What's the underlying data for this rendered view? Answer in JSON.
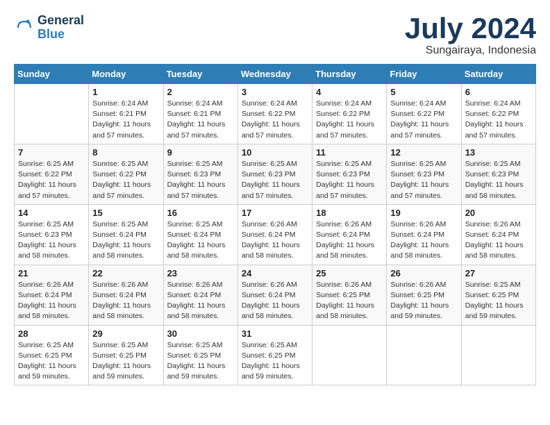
{
  "logo": {
    "line1": "General",
    "line2": "Blue"
  },
  "title": "July 2024",
  "subtitle": "Sungairaya, Indonesia",
  "weekdays": [
    "Sunday",
    "Monday",
    "Tuesday",
    "Wednesday",
    "Thursday",
    "Friday",
    "Saturday"
  ],
  "weeks": [
    [
      {
        "day": "",
        "info": ""
      },
      {
        "day": "1",
        "info": "Sunrise: 6:24 AM\nSunset: 6:21 PM\nDaylight: 11 hours\nand 57 minutes."
      },
      {
        "day": "2",
        "info": "Sunrise: 6:24 AM\nSunset: 6:21 PM\nDaylight: 11 hours\nand 57 minutes."
      },
      {
        "day": "3",
        "info": "Sunrise: 6:24 AM\nSunset: 6:22 PM\nDaylight: 11 hours\nand 57 minutes."
      },
      {
        "day": "4",
        "info": "Sunrise: 6:24 AM\nSunset: 6:22 PM\nDaylight: 11 hours\nand 57 minutes."
      },
      {
        "day": "5",
        "info": "Sunrise: 6:24 AM\nSunset: 6:22 PM\nDaylight: 11 hours\nand 57 minutes."
      },
      {
        "day": "6",
        "info": "Sunrise: 6:24 AM\nSunset: 6:22 PM\nDaylight: 11 hours\nand 57 minutes."
      }
    ],
    [
      {
        "day": "7",
        "info": "Sunrise: 6:25 AM\nSunset: 6:22 PM\nDaylight: 11 hours\nand 57 minutes."
      },
      {
        "day": "8",
        "info": "Sunrise: 6:25 AM\nSunset: 6:22 PM\nDaylight: 11 hours\nand 57 minutes."
      },
      {
        "day": "9",
        "info": "Sunrise: 6:25 AM\nSunset: 6:23 PM\nDaylight: 11 hours\nand 57 minutes."
      },
      {
        "day": "10",
        "info": "Sunrise: 6:25 AM\nSunset: 6:23 PM\nDaylight: 11 hours\nand 57 minutes."
      },
      {
        "day": "11",
        "info": "Sunrise: 6:25 AM\nSunset: 6:23 PM\nDaylight: 11 hours\nand 57 minutes."
      },
      {
        "day": "12",
        "info": "Sunrise: 6:25 AM\nSunset: 6:23 PM\nDaylight: 11 hours\nand 57 minutes."
      },
      {
        "day": "13",
        "info": "Sunrise: 6:25 AM\nSunset: 6:23 PM\nDaylight: 11 hours\nand 58 minutes."
      }
    ],
    [
      {
        "day": "14",
        "info": "Sunrise: 6:25 AM\nSunset: 6:23 PM\nDaylight: 11 hours\nand 58 minutes."
      },
      {
        "day": "15",
        "info": "Sunrise: 6:25 AM\nSunset: 6:24 PM\nDaylight: 11 hours\nand 58 minutes."
      },
      {
        "day": "16",
        "info": "Sunrise: 6:25 AM\nSunset: 6:24 PM\nDaylight: 11 hours\nand 58 minutes."
      },
      {
        "day": "17",
        "info": "Sunrise: 6:26 AM\nSunset: 6:24 PM\nDaylight: 11 hours\nand 58 minutes."
      },
      {
        "day": "18",
        "info": "Sunrise: 6:26 AM\nSunset: 6:24 PM\nDaylight: 11 hours\nand 58 minutes."
      },
      {
        "day": "19",
        "info": "Sunrise: 6:26 AM\nSunset: 6:24 PM\nDaylight: 11 hours\nand 58 minutes."
      },
      {
        "day": "20",
        "info": "Sunrise: 6:26 AM\nSunset: 6:24 PM\nDaylight: 11 hours\nand 58 minutes."
      }
    ],
    [
      {
        "day": "21",
        "info": "Sunrise: 6:26 AM\nSunset: 6:24 PM\nDaylight: 11 hours\nand 58 minutes."
      },
      {
        "day": "22",
        "info": "Sunrise: 6:26 AM\nSunset: 6:24 PM\nDaylight: 11 hours\nand 58 minutes."
      },
      {
        "day": "23",
        "info": "Sunrise: 6:26 AM\nSunset: 6:24 PM\nDaylight: 11 hours\nand 58 minutes."
      },
      {
        "day": "24",
        "info": "Sunrise: 6:26 AM\nSunset: 6:24 PM\nDaylight: 11 hours\nand 58 minutes."
      },
      {
        "day": "25",
        "info": "Sunrise: 6:26 AM\nSunset: 6:25 PM\nDaylight: 11 hours\nand 58 minutes."
      },
      {
        "day": "26",
        "info": "Sunrise: 6:26 AM\nSunset: 6:25 PM\nDaylight: 11 hours\nand 59 minutes."
      },
      {
        "day": "27",
        "info": "Sunrise: 6:25 AM\nSunset: 6:25 PM\nDaylight: 11 hours\nand 59 minutes."
      }
    ],
    [
      {
        "day": "28",
        "info": "Sunrise: 6:25 AM\nSunset: 6:25 PM\nDaylight: 11 hours\nand 59 minutes."
      },
      {
        "day": "29",
        "info": "Sunrise: 6:25 AM\nSunset: 6:25 PM\nDaylight: 11 hours\nand 59 minutes."
      },
      {
        "day": "30",
        "info": "Sunrise: 6:25 AM\nSunset: 6:25 PM\nDaylight: 11 hours\nand 59 minutes."
      },
      {
        "day": "31",
        "info": "Sunrise: 6:25 AM\nSunset: 6:25 PM\nDaylight: 11 hours\nand 59 minutes."
      },
      {
        "day": "",
        "info": ""
      },
      {
        "day": "",
        "info": ""
      },
      {
        "day": "",
        "info": ""
      }
    ]
  ]
}
